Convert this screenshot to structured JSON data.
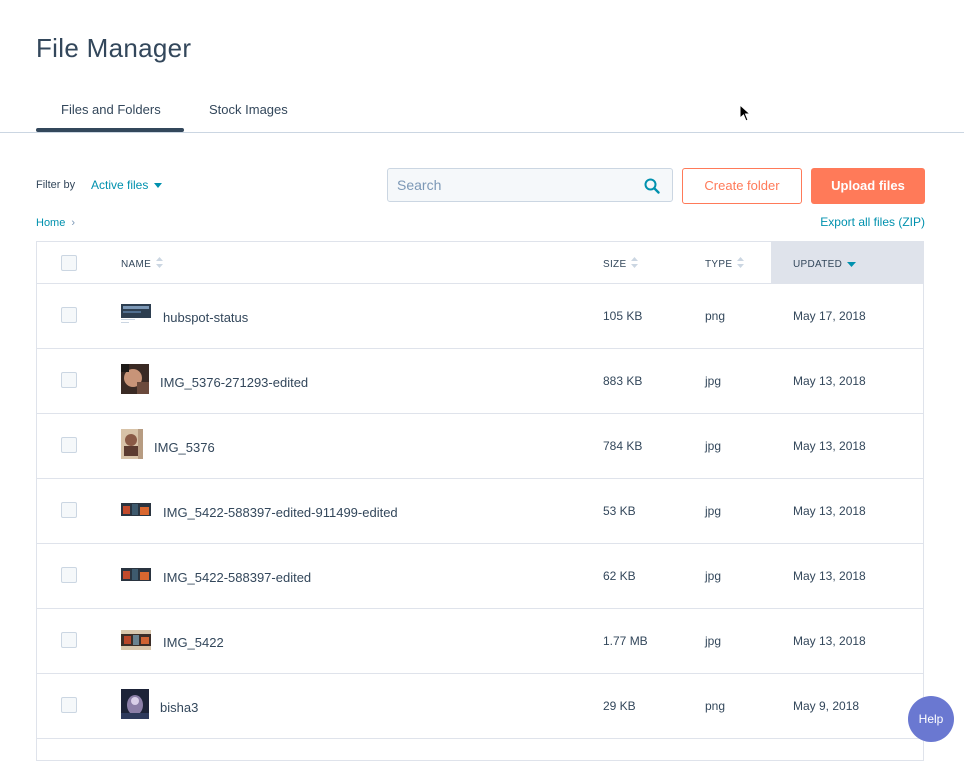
{
  "page": {
    "title": "File Manager"
  },
  "tabs": [
    {
      "label": "Files and Folders",
      "active": true
    },
    {
      "label": "Stock Images",
      "active": false
    }
  ],
  "filter": {
    "label": "Filter by",
    "value": "Active files"
  },
  "search": {
    "placeholder": "Search"
  },
  "buttons": {
    "create_folder": "Create folder",
    "upload_files": "Upload files"
  },
  "breadcrumb": {
    "home": "Home"
  },
  "export": {
    "label": "Export all files (ZIP)"
  },
  "table": {
    "columns": {
      "name": "NAME",
      "size": "SIZE",
      "type": "TYPE",
      "updated": "UPDATED"
    },
    "sorted_by": "updated",
    "rows": [
      {
        "name": "hubspot-status",
        "size": "105 KB",
        "type": "png",
        "updated": "May 17, 2018",
        "thumb": "screenshot"
      },
      {
        "name": "IMG_5376-271293-edited",
        "size": "883 KB",
        "type": "jpg",
        "updated": "May 13, 2018",
        "thumb": "photo-square"
      },
      {
        "name": "IMG_5376",
        "size": "784 KB",
        "type": "jpg",
        "updated": "May 13, 2018",
        "thumb": "photo-portrait"
      },
      {
        "name": "IMG_5422-588397-edited-911499-edited",
        "size": "53 KB",
        "type": "jpg",
        "updated": "May 13, 2018",
        "thumb": "photo-wide"
      },
      {
        "name": "IMG_5422-588397-edited",
        "size": "62 KB",
        "type": "jpg",
        "updated": "May 13, 2018",
        "thumb": "photo-wide"
      },
      {
        "name": "IMG_5422",
        "size": "1.77 MB",
        "type": "jpg",
        "updated": "May 13, 2018",
        "thumb": "photo-wide-2"
      },
      {
        "name": "bisha3",
        "size": "29 KB",
        "type": "png",
        "updated": "May 9, 2018",
        "thumb": "photo-square-2"
      }
    ]
  },
  "help": {
    "label": "Help"
  },
  "colors": {
    "accent": "#ff7a59",
    "link": "#0091ae",
    "text": "#33475b",
    "help": "#6a78d1"
  }
}
